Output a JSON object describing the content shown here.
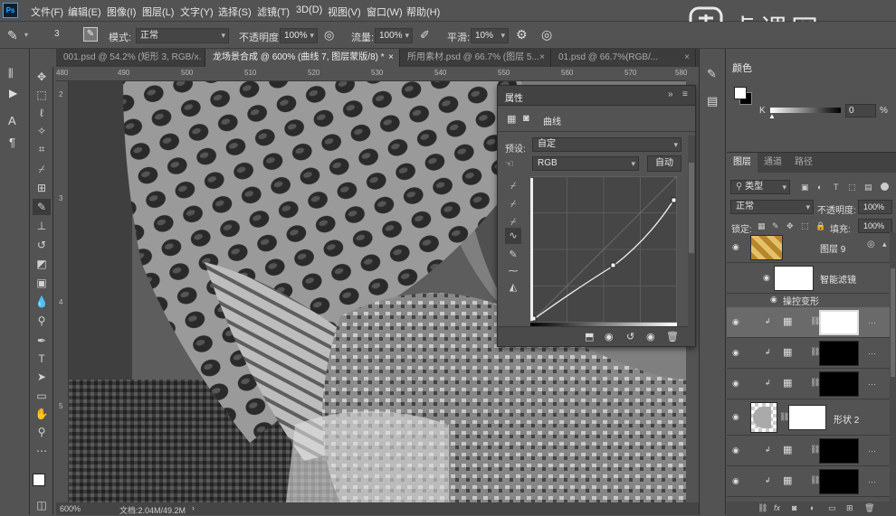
{
  "app_icon": "Ps",
  "menu": [
    "文件(F)",
    "编辑(E)",
    "图像(I)",
    "图层(L)",
    "文字(Y)",
    "选择(S)",
    "滤镜(T)",
    "3D(D)",
    "视图(V)",
    "窗口(W)",
    "帮助(H)"
  ],
  "watermark": "虎课网",
  "options": {
    "brush_size": "3",
    "mode_label": "模式:",
    "mode_value": "正常",
    "opacity_label": "不透明度:",
    "opacity_value": "100%",
    "flow_label": "流量:",
    "flow_value": "100%",
    "smooth_label": "平滑:",
    "smooth_value": "10%"
  },
  "tabs": [
    {
      "label": "001.psd @ 54.2% (矩形 3, RGB/...",
      "active": false
    },
    {
      "label": "龙场景合成 @ 600% (曲线 7, 图层蒙版/8) *",
      "active": true
    },
    {
      "label": "所用素材.psd @ 66.7% (图层 5...",
      "active": false
    },
    {
      "label": "01.psd @ 66.7%(RGB/...",
      "active": false
    }
  ],
  "ruler_top": [
    "480",
    "490",
    "500",
    "510",
    "520",
    "530",
    "540",
    "550",
    "560",
    "570",
    "580"
  ],
  "ruler_left": [
    "2",
    "3",
    "4",
    "5"
  ],
  "status": {
    "zoom": "600%",
    "doc": "文档:2.04M/49.2M"
  },
  "properties": {
    "title": "属性",
    "section": "曲线",
    "preset_label": "预设:",
    "preset_value": "自定",
    "channel": "RGB",
    "auto_button": "自动"
  },
  "color_panel": {
    "title": "颜色",
    "slider_label": "K",
    "slider_value": "0",
    "slider_unit": "%"
  },
  "layers_panel": {
    "tabs": [
      "图层",
      "通道",
      "路径"
    ],
    "filter_kind": "类型",
    "blend_mode": "正常",
    "opacity_label": "不透明度:",
    "opacity_value": "100%",
    "lock_label": "锁定:",
    "fill_label": "填充:",
    "fill_value": "100%",
    "layers": [
      {
        "name": "图层 9"
      },
      {
        "name": "智能滤镜"
      },
      {
        "name": "操控变形"
      },
      {
        "name": ""
      },
      {
        "name": ""
      },
      {
        "name": ""
      },
      {
        "name": "形状 2"
      },
      {
        "name": ""
      },
      {
        "name": ""
      }
    ]
  },
  "colors": {
    "accent": "#31a8ff",
    "bg": "#535353",
    "dark": "#3c3c3c"
  }
}
